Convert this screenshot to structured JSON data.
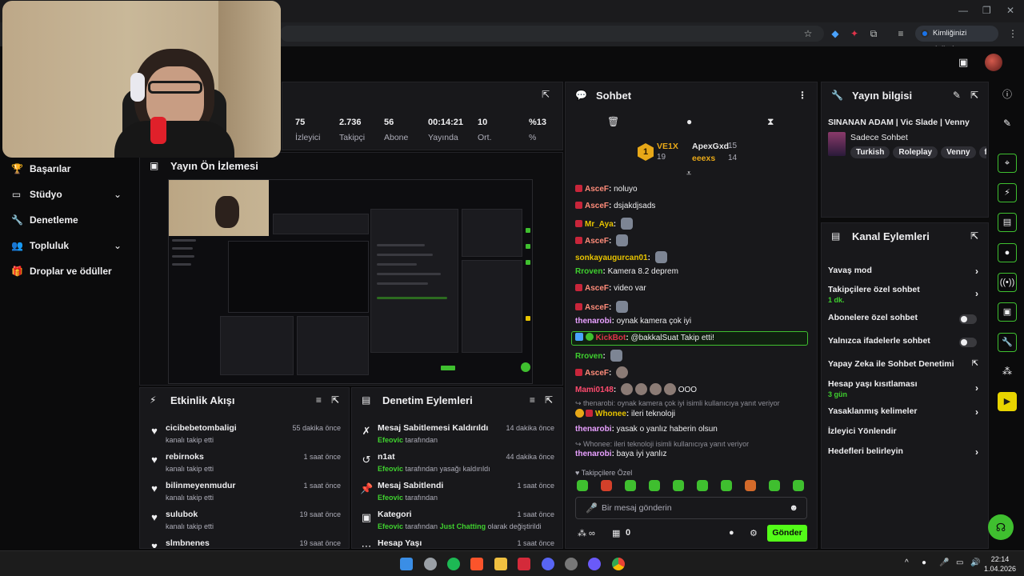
{
  "browser": {
    "verify_button": "Kimliğinizi doğrulayın"
  },
  "nav": {
    "items": [
      {
        "label": "Başarılar",
        "icon": "trophy-icon",
        "chevron": false
      },
      {
        "label": "Stüdyo",
        "icon": "studio-icon",
        "chevron": true
      },
      {
        "label": "Denetleme",
        "icon": "wrench-icon",
        "chevron": false
      },
      {
        "label": "Topluluk",
        "icon": "community-icon",
        "chevron": true
      },
      {
        "label": "Droplar ve ödüller",
        "icon": "gift-icon",
        "chevron": false
      }
    ]
  },
  "stats": [
    {
      "value": "75",
      "label": "İzleyici"
    },
    {
      "value": "2.736",
      "label": "Takipçi"
    },
    {
      "value": "56",
      "label": "Abone"
    },
    {
      "value": "00:14:21",
      "label": "Yayında"
    },
    {
      "value": "10",
      "label": "Ort."
    },
    {
      "value": "%13",
      "label": "%"
    }
  ],
  "preview": {
    "title": "Yayın Ön İzlemesi"
  },
  "activity": {
    "title": "Etkinlik Akışı",
    "items": [
      {
        "name": "cicibebetombaligi",
        "action": "kanalı takip etti",
        "time": "55 dakika önce"
      },
      {
        "name": "rebirnoks",
        "action": "kanalı takip etti",
        "time": "1 saat önce"
      },
      {
        "name": "bilinmeyenmudur",
        "action": "kanalı takip etti",
        "time": "1 saat önce"
      },
      {
        "name": "sulubok",
        "action": "kanalı takip etti",
        "time": "19 saat önce"
      },
      {
        "name": "slmbnenes",
        "action": "",
        "time": "19 saat önce"
      }
    ]
  },
  "moderation": {
    "title": "Denetim Eylemleri",
    "items": [
      {
        "title": "Mesaj Sabitlemesi Kaldırıldı",
        "actor": "Efeovic",
        "rest": "tarafından",
        "time": "14 dakika önce",
        "icon": "unpin-icon"
      },
      {
        "title": "n1at",
        "actor": "Efeovic",
        "rest": "tarafından yasağı kaldırıldı",
        "time": "44 dakika önce",
        "icon": "undo-icon"
      },
      {
        "title": "Mesaj Sabitlendi",
        "actor": "Efeovic",
        "rest": "tarafından",
        "time": "1 saat önce",
        "icon": "pin-icon"
      },
      {
        "title": "Kategori",
        "actor": "Efeovic",
        "rest": "tarafından",
        "category": "Just Chatting",
        "rest2": "olarak değiştirildi",
        "time": "1 saat önce",
        "icon": "category-icon"
      },
      {
        "title": "Hesap Yaşı",
        "actor": "",
        "rest": "",
        "time": "1 saat önce",
        "icon": "account-age-icon"
      }
    ]
  },
  "chat": {
    "title": "Sohbet",
    "leaderboard": [
      {
        "name": "VE1X",
        "count": "19"
      },
      {
        "name": "ApexGxd",
        "count": "15"
      },
      {
        "name": "eeexs",
        "count": "14"
      }
    ],
    "messages": [
      {
        "user": "AsceF",
        "text": "noluyo",
        "color": "#ff8c7a",
        "badge": true
      },
      {
        "user": "AsceF",
        "text": "dsjakdjsads",
        "color": "#ff8c7a",
        "badge": true
      },
      {
        "user": "Mr_Aya",
        "text": "",
        "color": "#e8c400",
        "badge": true,
        "emotes": 1
      },
      {
        "user": "AsceF",
        "text": "",
        "color": "#ff8c7a",
        "badge": true,
        "emotes": 1
      },
      {
        "user": "sonkayaugurcan01",
        "text": "",
        "color": "#e8c400",
        "badge": false,
        "emotes": 1
      },
      {
        "user": "Rroven",
        "text": "Kamera 8.2 deprem",
        "color": "#3fd02f",
        "badge": false
      },
      {
        "user": "AsceF",
        "text": "video var",
        "color": "#ff8c7a",
        "badge": true
      },
      {
        "user": "AsceF",
        "text": "",
        "color": "#ff8c7a",
        "badge": true,
        "emotes": 1
      },
      {
        "user": "thenarobi",
        "text": "oynak kamera çok iyi",
        "color": "#e8a0ff",
        "badge": false
      }
    ],
    "follow_alert": {
      "user": "KickBot",
      "target": "@bakkalSuat",
      "text": "Takip etti!"
    },
    "messages2": [
      {
        "user": "Rroven",
        "text": "",
        "color": "#3fd02f",
        "emotes": 1
      },
      {
        "user": "AsceF",
        "text": "",
        "color": "#ff8c7a",
        "badge": true,
        "emotes": 1
      },
      {
        "user": "Mami0148",
        "text": "OOO",
        "color": "#ff4b6e",
        "emotes": 4
      }
    ],
    "reply1": "thenarobi: oynak kamera çok iyi isimli kullanıcıya yanıt veriyor",
    "reply1_msg": {
      "user": "Whonee",
      "text": "ileri teknoloji",
      "color": "#e8c400"
    },
    "msg_yasak": {
      "user": "thenarobi",
      "text": "yasak o yanlız haberin olsun",
      "color": "#e8a0ff"
    },
    "reply2": "Whonee: ileri teknoloji isimli kullanıcıya yanıt veriyor",
    "reply2_msg": {
      "user": "thenarobi",
      "text": "baya iyi yanlız",
      "color": "#e8a0ff"
    },
    "followers_only": "Takipçilere Özel",
    "input_placeholder": "Bir mesaj gönderin",
    "points": "0",
    "send": "Gönder"
  },
  "info": {
    "title": "Yayın bilgisi",
    "stream_title": "SINANAN ADAM | Vic Slade | Venny",
    "category": "Sadece Sohbet",
    "tags": [
      "Turkish",
      "Roleplay",
      "Venny",
      "fiv"
    ]
  },
  "channel": {
    "title": "Kanal Eylemleri",
    "rows": [
      {
        "label": "Yavaş mod",
        "sub": "",
        "control": "chevron"
      },
      {
        "label": "Takipçilere özel sohbet",
        "sub": "1 dk.",
        "control": "chevron"
      },
      {
        "label": "Abonelere özel sohbet",
        "sub": "",
        "control": "toggle"
      },
      {
        "label": "Yalnızca ifadelerle sohbet",
        "sub": "",
        "control": "toggle"
      },
      {
        "label": "Yapay Zeka ile Sohbet Denetimi",
        "sub": "",
        "control": "external"
      },
      {
        "label": "Hesap yaşı kısıtlaması",
        "sub": "3 gün",
        "control": "chevron"
      },
      {
        "label": "Yasaklanmış kelimeler",
        "sub": "",
        "control": "chevron"
      },
      {
        "label": "İzleyici Yönlendir",
        "sub": "",
        "control": "none"
      },
      {
        "label": "Hedefleri belirleyin",
        "sub": "",
        "control": "chevron"
      }
    ]
  },
  "taskbar": {
    "time": "22:14",
    "date": "1.04.2026"
  },
  "colors": {
    "accent": "#53fc18",
    "panel": "#18181b",
    "bg": "#0b0b0c"
  }
}
